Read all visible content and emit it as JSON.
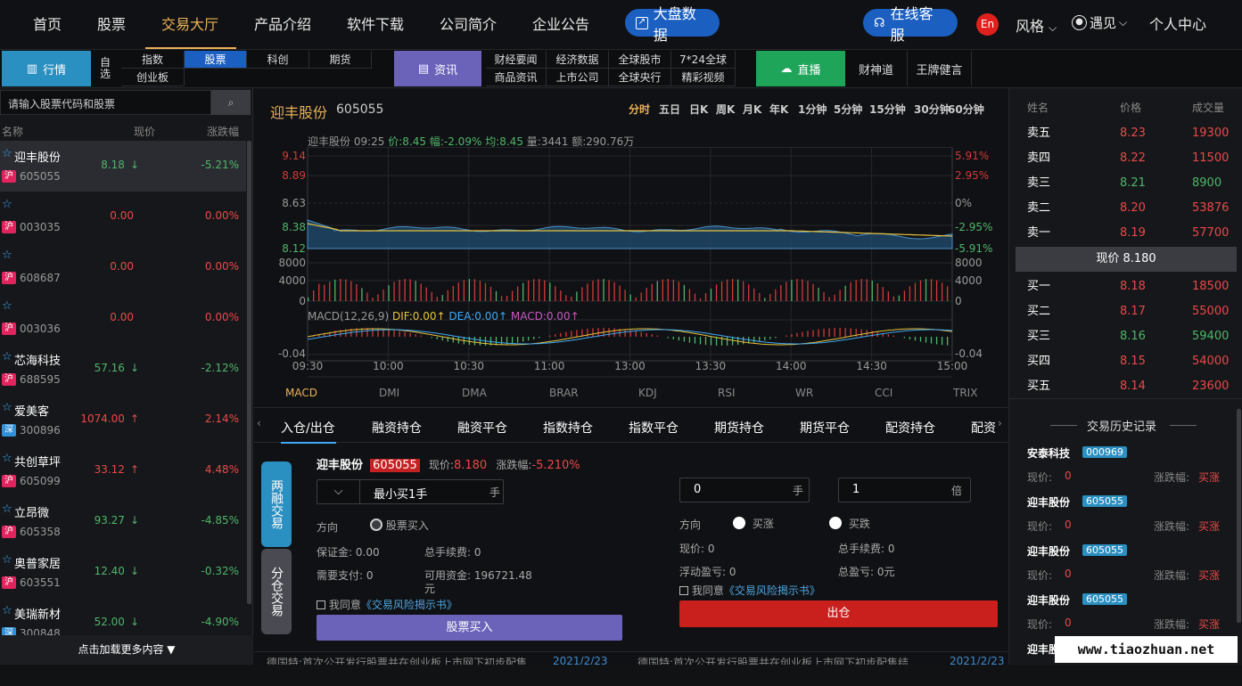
{
  "topnav": {
    "items": [
      "首页",
      "股票",
      "交易大厅",
      "产品介绍",
      "软件下载",
      "公司简介",
      "企业公告"
    ],
    "market_btn": "大盘数据",
    "service_btn": "在线客服",
    "lang": "En",
    "style_label": "风格",
    "user_label": "遇见",
    "personal": "个人中心"
  },
  "subnav": {
    "market_tab": "行情",
    "self_select": "自选",
    "grid1": [
      "指数",
      "股票",
      "科创",
      "期货",
      "创业板"
    ],
    "news_tab": "资讯",
    "grid2": [
      "财经要闻",
      "经济数据",
      "全球股市",
      "7*24全球",
      "商品资讯",
      "上市公司",
      "全球央行",
      "精彩视频"
    ],
    "live_tab": "直播",
    "live_links": [
      "财神道",
      "王牌健言"
    ]
  },
  "left": {
    "search_placeholder": "请输入股票代码和股票",
    "headers": [
      "名称",
      "现价",
      "涨跌幅"
    ],
    "stocks": [
      {
        "name": "迎丰股份",
        "code": "605055",
        "exch": "沪",
        "price": "8.18",
        "arrow": "↓",
        "change": "-5.21%",
        "dir": "dn"
      },
      {
        "name": "",
        "code": "003035",
        "exch": "沪",
        "price": "0.00",
        "arrow": "",
        "change": "0.00%",
        "dir": "up"
      },
      {
        "name": "",
        "code": "608687",
        "exch": "沪",
        "price": "0.00",
        "arrow": "",
        "change": "0.00%",
        "dir": "up"
      },
      {
        "name": "",
        "code": "003036",
        "exch": "沪",
        "price": "0.00",
        "arrow": "",
        "change": "0.00%",
        "dir": "up"
      },
      {
        "name": "芯海科技",
        "code": "688595",
        "exch": "沪",
        "price": "57.16",
        "arrow": "↓",
        "change": "-2.12%",
        "dir": "dn"
      },
      {
        "name": "爱美客",
        "code": "300896",
        "exch": "深",
        "price": "1074.00",
        "arrow": "↑",
        "change": "2.14%",
        "dir": "up"
      },
      {
        "name": "共创草坪",
        "code": "605099",
        "exch": "沪",
        "price": "33.12",
        "arrow": "↑",
        "change": "4.48%",
        "dir": "up"
      },
      {
        "name": "立昂微",
        "code": "605358",
        "exch": "沪",
        "price": "93.27",
        "arrow": "↓",
        "change": "-4.85%",
        "dir": "dn"
      },
      {
        "name": "奥普家居",
        "code": "603551",
        "exch": "沪",
        "price": "12.40",
        "arrow": "↓",
        "change": "-0.32%",
        "dir": "dn"
      },
      {
        "name": "美瑞新材",
        "code": "300848",
        "exch": "深",
        "price": "52.00",
        "arrow": "↓",
        "change": "-4.90%",
        "dir": "dn"
      }
    ],
    "load_more": "点击加载更多内容 ▼"
  },
  "chart": {
    "stock_name": "迎丰股份",
    "stock_code": "605055",
    "periods": [
      "分时",
      "五日",
      "日K",
      "周K",
      "月K",
      "年K",
      "1分钟",
      "5分钟",
      "15分钟",
      "30分钟",
      "60分钟"
    ],
    "info": {
      "name": "迎丰股份",
      "time": "09:25",
      "price": "价:8.45",
      "rate": "幅:-2.09%",
      "avg": "均:8.45",
      "vol": "量:3441",
      "amount": "额:290.76万"
    },
    "left_ticks": [
      "9.14",
      "8.89",
      "8.63",
      "8.38",
      "8.12"
    ],
    "right_ticks": [
      "5.91%",
      "2.95%",
      "0%",
      "-2.95%",
      "-5.91%"
    ],
    "vol_ticks": [
      "8000",
      "4000",
      "0"
    ],
    "macd_label": "MACD(12,26,9)",
    "dif": "DIF:0.00↑",
    "dea": "DEA:0.00↑",
    "macd_val": "MACD:0.00↑",
    "macd_tick": "-0.04",
    "times": [
      "09:30",
      "10:00",
      "10:30",
      "11:00",
      "13:00",
      "13:30",
      "14:00",
      "14:30",
      "15:00"
    ],
    "indicators": [
      "MACD",
      "DMI",
      "DMA",
      "BRAR",
      "KDJ",
      "RSI",
      "WR",
      "CCI",
      "TRIX"
    ]
  },
  "trade": {
    "tabs": [
      "入仓/出仓",
      "融资持仓",
      "融资平仓",
      "指数持仓",
      "指数平仓",
      "期货持仓",
      "期货平仓",
      "配资持仓",
      "配资"
    ],
    "side_tabs": [
      "两融交易",
      "分仓交易"
    ],
    "stock_name": "迎丰股份",
    "stock_code": "605055",
    "price_label": "现价:",
    "price": "8.180",
    "change_label": "涨跌幅:",
    "change": "-5.210%",
    "lot_value": "最小买1手",
    "lot_unit": "手",
    "direction_label": "方向",
    "buy_option": "股票买入",
    "margin_label": "保证金:",
    "margin": "0.00",
    "fee_label": "总手续费:",
    "fee": "0",
    "pay_label": "需要支付:",
    "pay": "0",
    "available_label": "可用资金:",
    "available": "196721.48",
    "available_unit": "元",
    "agree_text": "我同意",
    "agree_link": "《交易风险揭示书》",
    "buy_btn": "股票买入",
    "qty_value": "0",
    "qty_unit": "手",
    "mult_value": "1",
    "mult_unit": "倍",
    "rise": "买涨",
    "fall": "买跌",
    "r_price": "现价:",
    "r_price_v": "0",
    "r_fee": "总手续费:",
    "r_fee_v": "0",
    "float_pl": "浮动盈亏:",
    "float_pl_v": "0",
    "total_pl": "总盈亏:",
    "total_pl_v": "0元",
    "sell_btn": "出仓"
  },
  "ticker": [
    {
      "text": "德国特:首次公开发行股票并在创业板上市网下初步配售",
      "date": "2021/2/23"
    },
    {
      "text": "德国特:首次公开发行股票并在创业板上市网下初步配售结",
      "date": "2021/2/23"
    }
  ],
  "orderbook": {
    "headers": [
      "姓名",
      "价格",
      "成交量"
    ],
    "asks": [
      {
        "label": "卖五",
        "price": "8.23",
        "vol": "19300",
        "dir": "up"
      },
      {
        "label": "卖四",
        "price": "8.22",
        "vol": "11500",
        "dir": "up"
      },
      {
        "label": "卖三",
        "price": "8.21",
        "vol": "8900",
        "dir": "dn"
      },
      {
        "label": "卖二",
        "price": "8.20",
        "vol": "53876",
        "dir": "up"
      },
      {
        "label": "卖一",
        "price": "8.19",
        "vol": "57700",
        "dir": "up"
      }
    ],
    "current": "现价 8.180",
    "bids": [
      {
        "label": "买一",
        "price": "8.18",
        "vol": "18500",
        "dir": "up"
      },
      {
        "label": "买二",
        "price": "8.17",
        "vol": "55000",
        "dir": "up"
      },
      {
        "label": "买三",
        "price": "8.16",
        "vol": "59400",
        "dir": "dn"
      },
      {
        "label": "买四",
        "price": "8.15",
        "vol": "54000",
        "dir": "up"
      },
      {
        "label": "买五",
        "price": "8.14",
        "vol": "23600",
        "dir": "up"
      }
    ]
  },
  "history": {
    "title": "交易历史记录",
    "items": [
      {
        "name": "安泰科技",
        "code": "000969",
        "price_label": "现价:",
        "price": "0",
        "change_label": "涨跌幅:",
        "dir": "买涨"
      },
      {
        "name": "迎丰股份",
        "code": "605055",
        "price_label": "现价:",
        "price": "0",
        "change_label": "涨跌幅:",
        "dir": "买涨"
      },
      {
        "name": "迎丰股份",
        "code": "605055",
        "price_label": "现价:",
        "price": "0",
        "change_label": "涨跌幅:",
        "dir": "买涨"
      },
      {
        "name": "迎丰股份",
        "code": "605055",
        "price_label": "现价:",
        "price": "0",
        "change_label": "涨跌幅:",
        "dir": "买涨"
      },
      {
        "name": "迎丰股份",
        "code": "",
        "price_label": "",
        "price": "",
        "change_label": "",
        "dir": ""
      }
    ]
  },
  "watermark": "www.tiaozhuan.net"
}
